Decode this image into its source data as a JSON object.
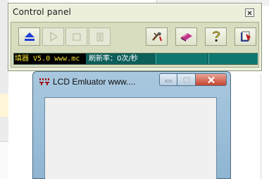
{
  "control_panel": {
    "title": "Control panel",
    "toolbar": [
      {
        "name": "eject-button",
        "icon": "eject-icon",
        "enabled": true
      },
      {
        "name": "play-button",
        "icon": "play-icon",
        "enabled": false
      },
      {
        "name": "stop-button",
        "icon": "stop-icon",
        "enabled": false
      },
      {
        "name": "pause-button",
        "icon": "pause-icon",
        "enabled": false
      },
      {
        "name": "settings-button",
        "icon": "tools-icon",
        "enabled": true
      },
      {
        "name": "manual-button",
        "icon": "book-icon",
        "enabled": true
      },
      {
        "name": "help-button",
        "icon": "question-icon",
        "enabled": true
      },
      {
        "name": "about-button",
        "icon": "info-book-icon",
        "enabled": true
      }
    ],
    "status": {
      "version_text": "填器 V5.0 www.mc",
      "refresh_rate_text": "刷新率：0次/秒"
    },
    "colors": {
      "window_bg": "#ecefdc",
      "status_teal": "#0e6560",
      "version_fg": "#f2e034"
    }
  },
  "lcd_window": {
    "title": "LCD Emluator    www....",
    "icon": "lcd-app-icon",
    "buttons": {
      "minimize": "minimize-icon",
      "maximize": "maximize-icon",
      "close": "close-icon"
    }
  }
}
